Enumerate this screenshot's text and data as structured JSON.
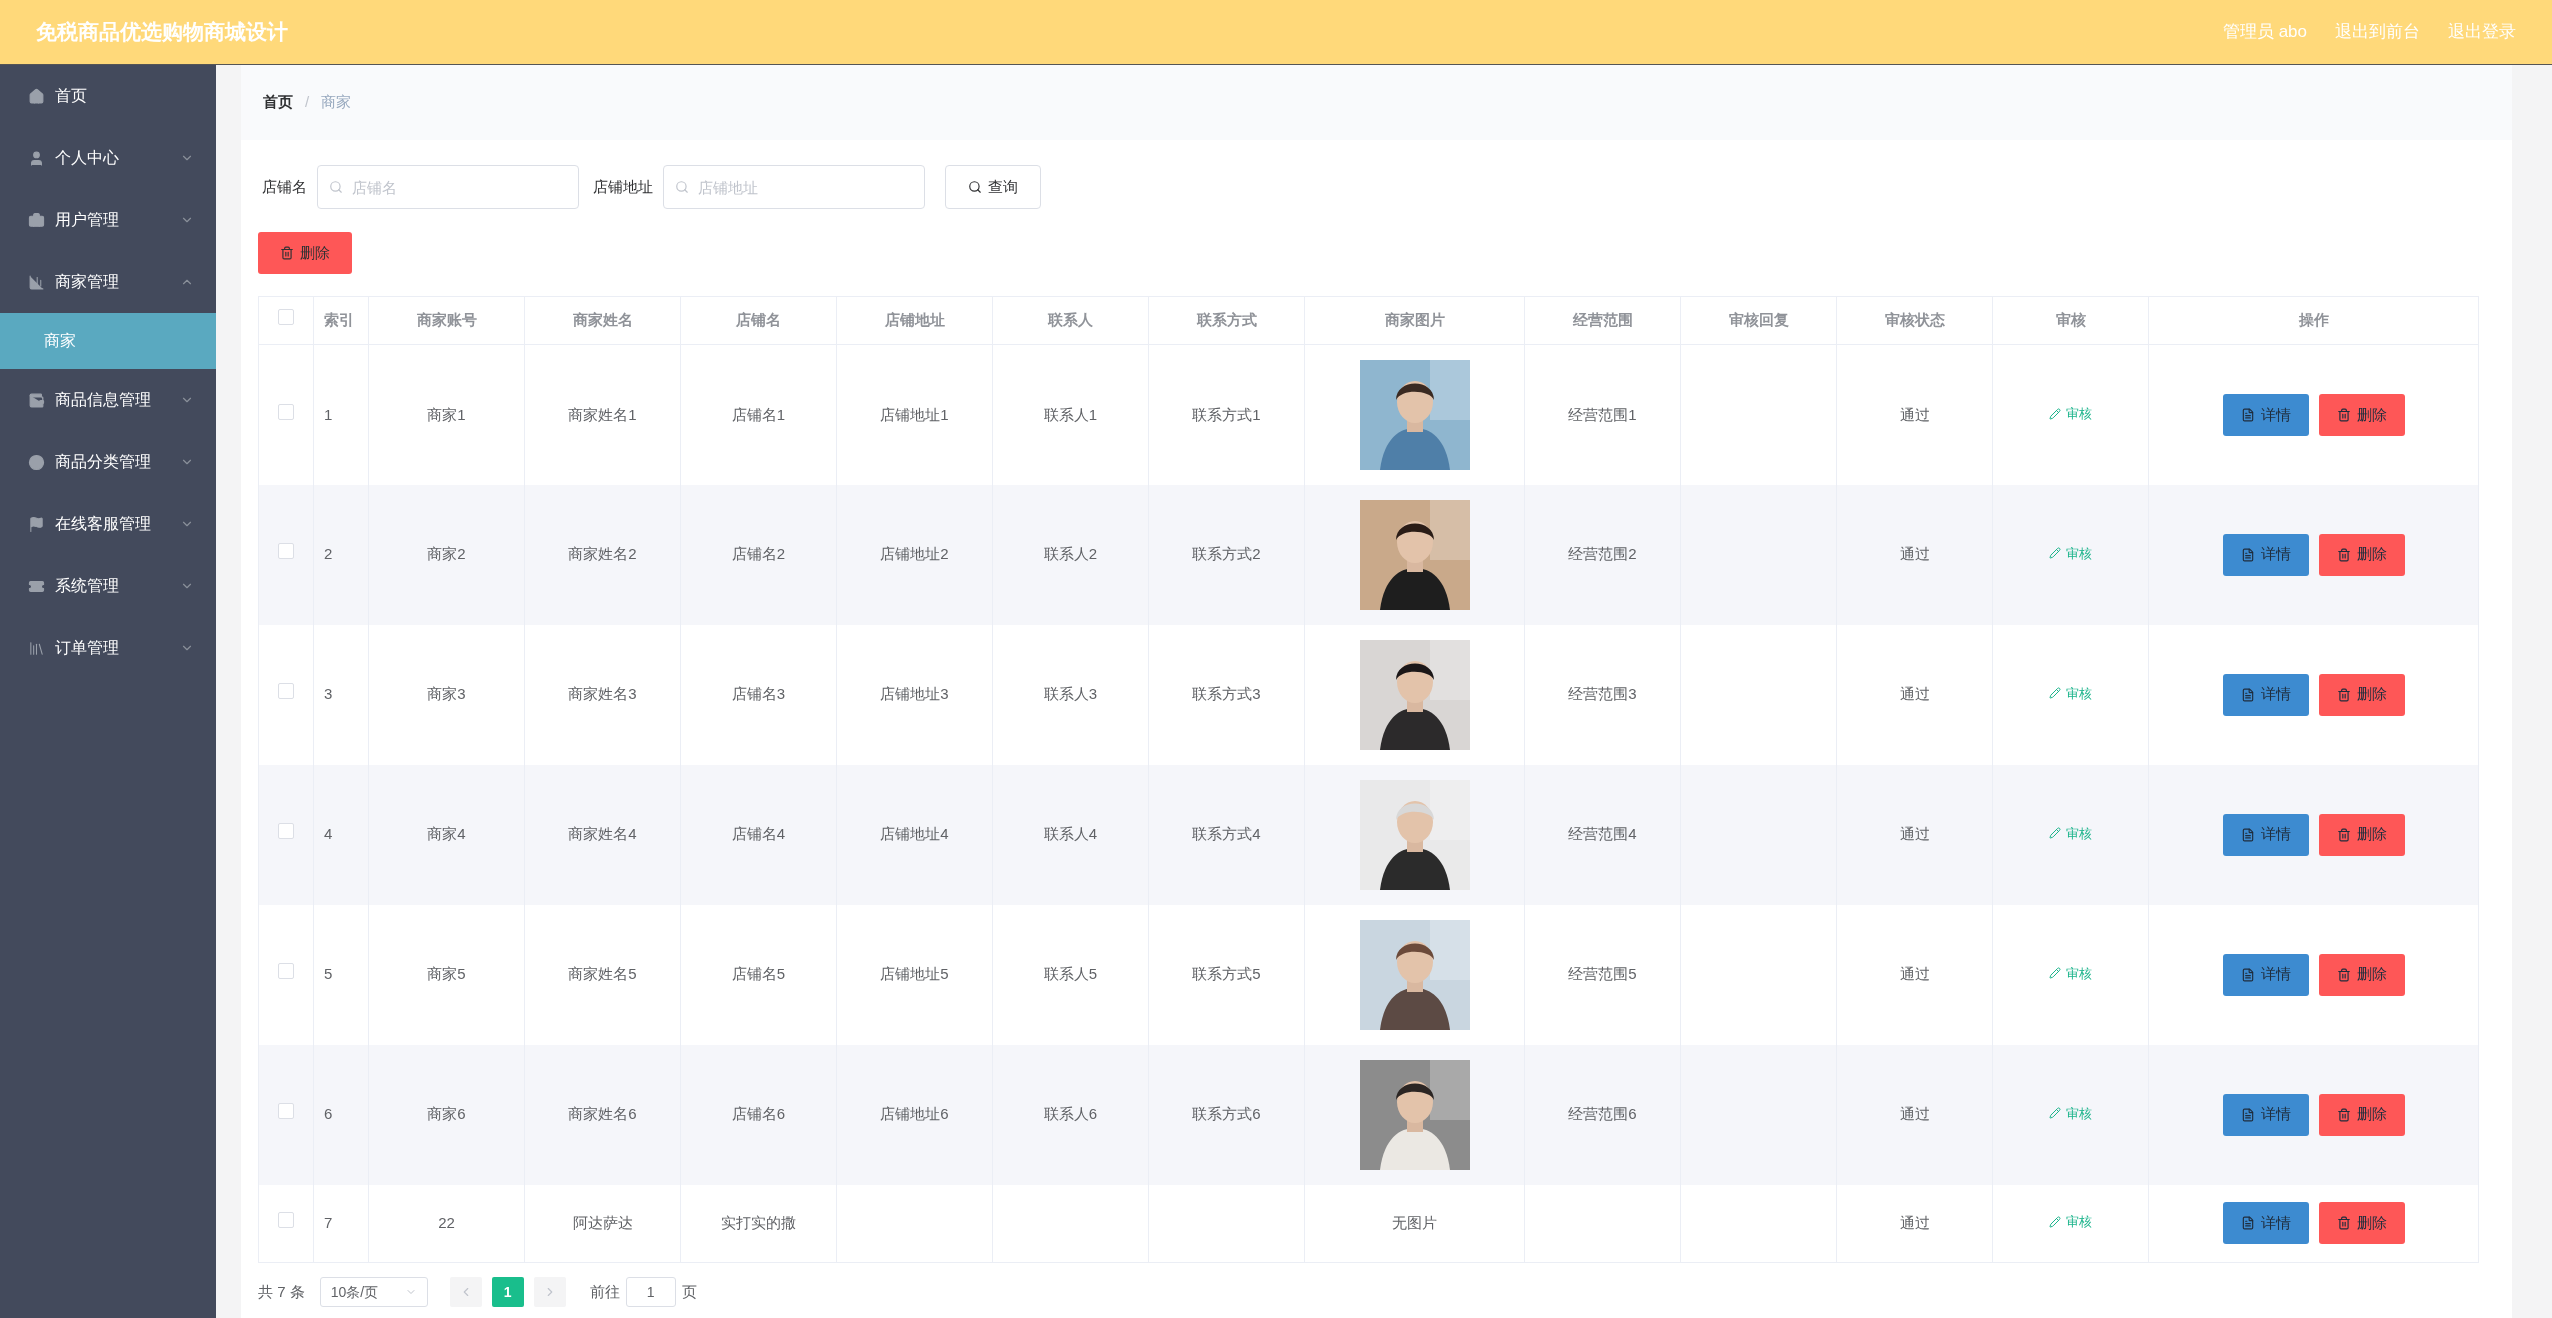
{
  "header": {
    "title": "免税商品优选购物商城设计",
    "user": "管理员 abo",
    "links": [
      "退出到前台",
      "退出登录"
    ]
  },
  "sidebar": {
    "items": [
      {
        "label": "首页",
        "kind": "link"
      },
      {
        "label": "个人中心",
        "kind": "menu",
        "expanded": false
      },
      {
        "label": "用户管理",
        "kind": "menu",
        "expanded": false
      },
      {
        "label": "商家管理",
        "kind": "menu",
        "expanded": true,
        "children": [
          {
            "label": "商家",
            "selected": true
          }
        ]
      },
      {
        "label": "商品信息管理",
        "kind": "menu",
        "expanded": false
      },
      {
        "label": "商品分类管理",
        "kind": "menu",
        "expanded": false
      },
      {
        "label": "在线客服管理",
        "kind": "menu",
        "expanded": false
      },
      {
        "label": "系统管理",
        "kind": "menu",
        "expanded": false
      },
      {
        "label": "订单管理",
        "kind": "menu",
        "expanded": false
      }
    ]
  },
  "breadcrumb": {
    "items": [
      "首页",
      "商家"
    ],
    "separator": "/"
  },
  "search": {
    "fields": [
      {
        "label": "店铺名",
        "placeholder": "店铺名"
      },
      {
        "label": "店铺地址",
        "placeholder": "店铺地址"
      }
    ],
    "button": "查询"
  },
  "delete_button": "删除",
  "table": {
    "all_checked": false,
    "columns": [
      "索引",
      "商家账号",
      "商家姓名",
      "店铺名",
      "店铺地址",
      "联系人",
      "联系方式",
      "商家图片",
      "经营范围",
      "审核回复",
      "审核状态",
      "审核",
      "操作"
    ],
    "rows": [
      {
        "checked": false,
        "index": "1",
        "account": "商家1",
        "name": "商家姓名1",
        "shop": "店铺名1",
        "address": "店铺地址1",
        "contact": "联系人1",
        "phone": "联系方式1",
        "scope": "经营范围1",
        "status": "通过",
        "review": "审核",
        "actions": [
          "详情",
          "删除"
        ]
      },
      {
        "checked": false,
        "index": "2",
        "account": "商家2",
        "name": "商家姓名2",
        "shop": "店铺名2",
        "address": "店铺地址2",
        "contact": "联系人2",
        "phone": "联系方式2",
        "scope": "经营范围2",
        "status": "通过",
        "review": "审核",
        "actions": [
          "详情",
          "删除"
        ]
      },
      {
        "checked": false,
        "index": "3",
        "account": "商家3",
        "name": "商家姓名3",
        "shop": "店铺名3",
        "address": "店铺地址3",
        "contact": "联系人3",
        "phone": "联系方式3",
        "scope": "经营范围3",
        "status": "通过",
        "review": "审核",
        "actions": [
          "详情",
          "删除"
        ]
      },
      {
        "checked": false,
        "index": "4",
        "account": "商家4",
        "name": "商家姓名4",
        "shop": "店铺名4",
        "address": "店铺地址4",
        "contact": "联系人4",
        "phone": "联系方式4",
        "scope": "经营范围4",
        "status": "通过",
        "review": "审核",
        "actions": [
          "详情",
          "删除"
        ]
      },
      {
        "checked": false,
        "index": "5",
        "account": "商家5",
        "name": "商家姓名5",
        "shop": "店铺名5",
        "address": "店铺地址5",
        "contact": "联系人5",
        "phone": "联系方式5",
        "scope": "经营范围5",
        "status": "通过",
        "review": "审核",
        "actions": [
          "详情",
          "删除"
        ]
      },
      {
        "checked": false,
        "index": "6",
        "account": "商家6",
        "name": "商家姓名6",
        "shop": "店铺名6",
        "address": "店铺地址6",
        "contact": "联系人6",
        "phone": "联系方式6",
        "scope": "经营范围6",
        "status": "通过",
        "review": "审核",
        "actions": [
          "详情",
          "删除"
        ]
      },
      {
        "checked": false,
        "index": "7",
        "account": "22",
        "name": "阿达萨达",
        "shop": "实打实的撒",
        "image": {
          "kind": "text",
          "text": "无图片"
        },
        "status": "通过",
        "review": "审核",
        "actions": [
          "详情",
          "删除"
        ]
      }
    ]
  },
  "pagination": {
    "total": "共 7 条",
    "page_size": "10条/页",
    "pages": [
      {
        "label": "1",
        "selected": true
      }
    ],
    "goto_label": "前往",
    "goto_value": "1",
    "goto_suffix": "页"
  }
}
